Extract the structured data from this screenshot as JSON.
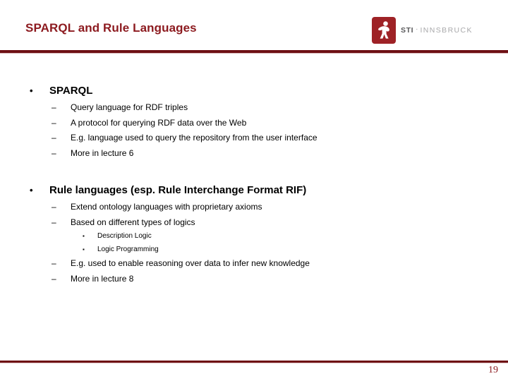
{
  "slide": {
    "title": "SPARQL and Rule Languages",
    "page_number": "19",
    "accent_color": "#8c1a1f",
    "rule_color": "#6e1014"
  },
  "logo": {
    "mark_color": "#9e2226",
    "primary_text": "STI",
    "separator": "·",
    "secondary_text": "INNSBRUCK"
  },
  "markers": {
    "level1": "•",
    "level2": "–",
    "level3": "▪"
  },
  "content": {
    "groups": [
      {
        "heading": "SPARQL",
        "items": [
          {
            "text": "Query language for RDF triples"
          },
          {
            "text": "A protocol for querying RDF data over the Web"
          },
          {
            "text": "E.g. language used to query the repository from the user interface"
          },
          {
            "text": "More in lecture 6"
          }
        ]
      },
      {
        "heading": "Rule languages (esp. Rule Interchange Format RIF)",
        "items": [
          {
            "text": "Extend ontology languages with proprietary axioms"
          },
          {
            "text": "Based on different types of logics"
          },
          {
            "text": "Description Logic",
            "level": 3
          },
          {
            "text": "Logic Programming",
            "level": 3
          },
          {
            "text": "E.g. used to enable reasoning over data to infer new knowledge"
          },
          {
            "text": "More in lecture 8"
          }
        ]
      }
    ]
  }
}
